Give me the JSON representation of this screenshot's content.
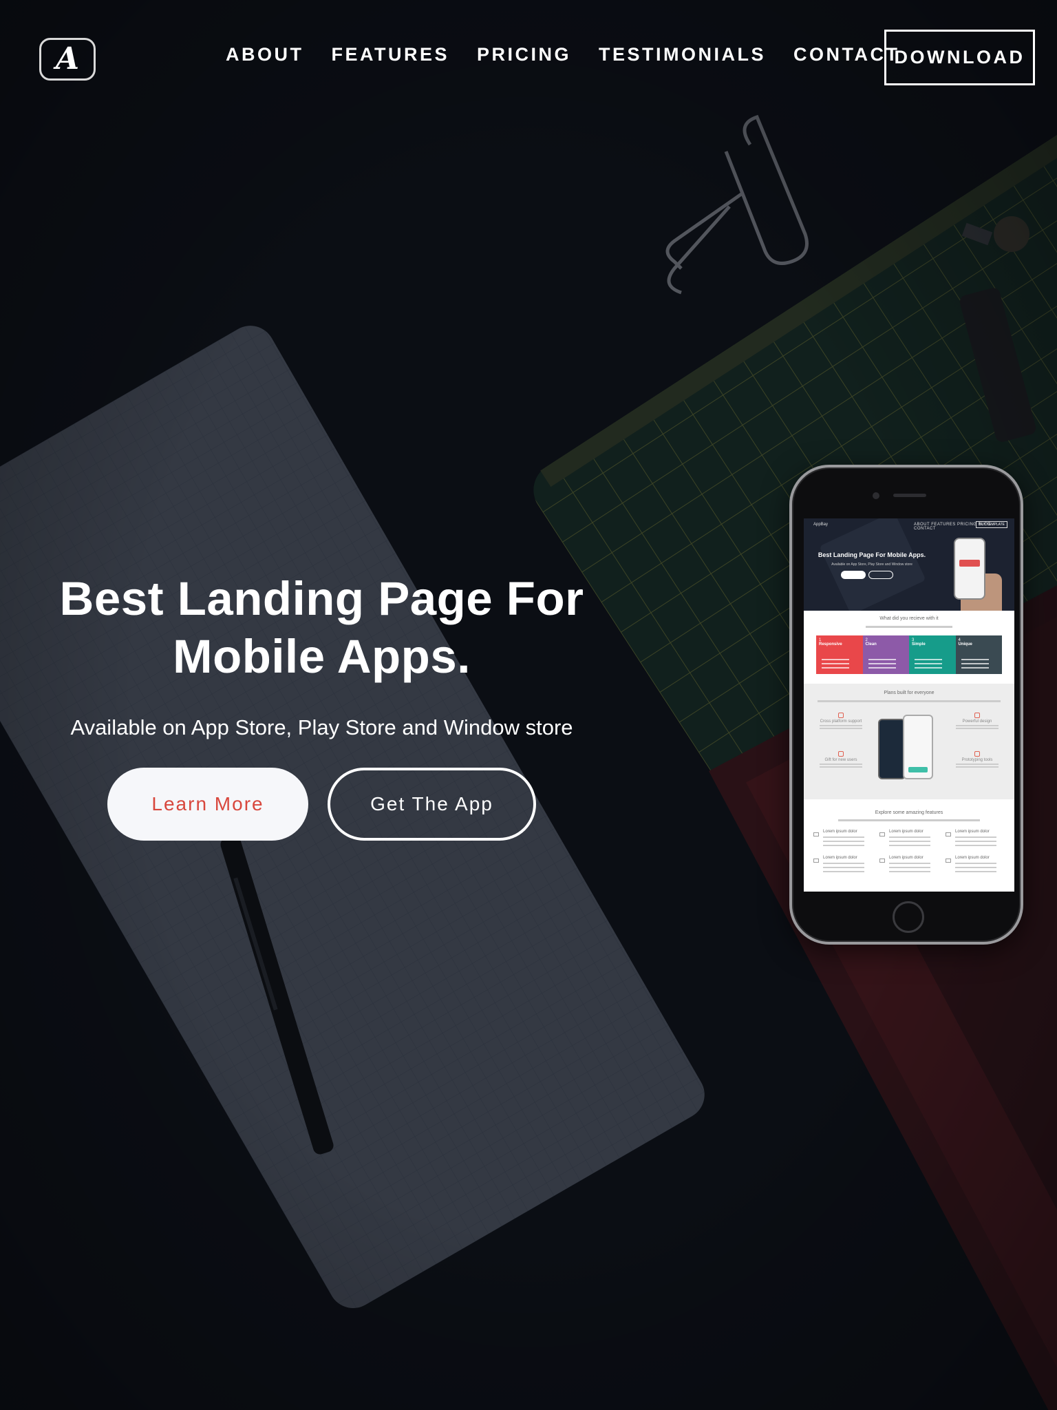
{
  "brand": {
    "logo_glyph": "A"
  },
  "nav": {
    "items": [
      {
        "label": "ABOUT"
      },
      {
        "label": "FEATURES"
      },
      {
        "label": "PRICING"
      },
      {
        "label": "TESTIMONIALS"
      },
      {
        "label": "CONTACT"
      }
    ],
    "download_label": "DOWNLOAD"
  },
  "hero": {
    "headline_line1": "Best Landing Page For",
    "headline_line2": "Mobile Apps.",
    "subline": "Available on App Store, Play Store and Window store",
    "learn_more_label": "Learn More",
    "get_app_label": "Get The App"
  },
  "phone_preview": {
    "nav_logo": "AppBay",
    "nav_items": "ABOUT  FEATURES  PRICING  BLOG  CONTACT",
    "nav_button": "BUY TEMPLATE",
    "title": "Best Landing Page For Mobile Apps.",
    "subtitle": "Available on App Store, Play Store and Window store",
    "section1_title": "What did you recieve with it",
    "cards": [
      {
        "num": "1",
        "label": "Responsive",
        "color": "#e9474a"
      },
      {
        "num": "2",
        "label": "Clean",
        "color": "#8d5aa8"
      },
      {
        "num": "3",
        "label": "Simple",
        "color": "#169c8a"
      },
      {
        "num": "4",
        "label": "Unique",
        "color": "#3a4a52"
      }
    ],
    "section2_title": "Plans built for everyone",
    "features": [
      {
        "label": "Cross platform support"
      },
      {
        "label": "Powerful design"
      },
      {
        "label": "Gift for new users"
      },
      {
        "label": "Prototyping tools"
      }
    ],
    "section3_title": "Explore some amazing features",
    "grid_item_label": "Lorem ipsum dolor"
  },
  "colors": {
    "background": "#0b0e14",
    "accent_red": "#d8473d",
    "button_light": "#f6f7fa"
  }
}
